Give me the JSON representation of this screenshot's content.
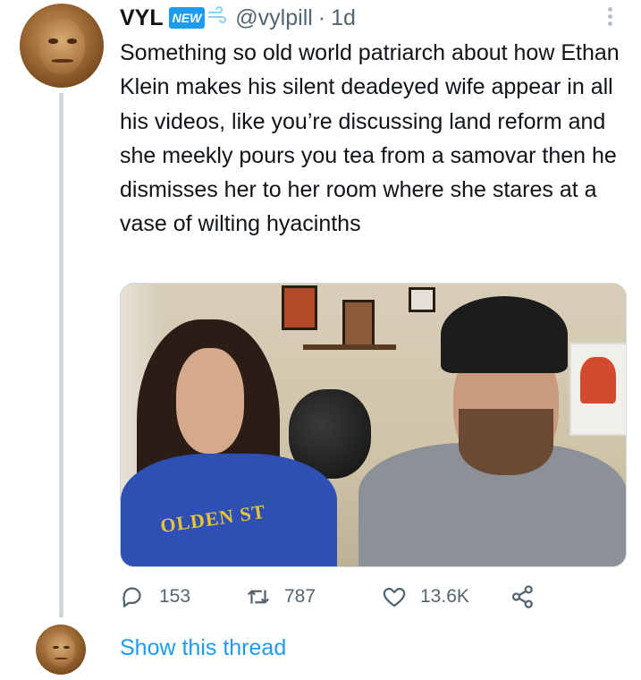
{
  "tweet": {
    "author_name": "VYL",
    "badge": "NEW",
    "handle": "@vylpill",
    "separator": "·",
    "time": "1d",
    "text": "Something so old world patriarch about how Ethan Klein makes his silent deadeyed wife appear in all his videos, like you’re discussing land reform and she meekly pours you tea from a samovar then he dismisses her to her room where she stares at a vase of wilting hyacinths",
    "media_text": "OLDEN ST",
    "actions": {
      "replies": "153",
      "retweets": "787",
      "likes": "13.6K"
    }
  },
  "thread": {
    "show_label": "Show this thread"
  },
  "icons": {
    "badge_icon": "wind-icon",
    "more": "more-dots-icon",
    "reply": "reply-icon",
    "retweet": "retweet-icon",
    "like": "heart-icon",
    "share": "share-icon"
  },
  "colors": {
    "accent": "#1d9bf0",
    "muted": "#536471",
    "thread_line": "#cfd9de"
  }
}
